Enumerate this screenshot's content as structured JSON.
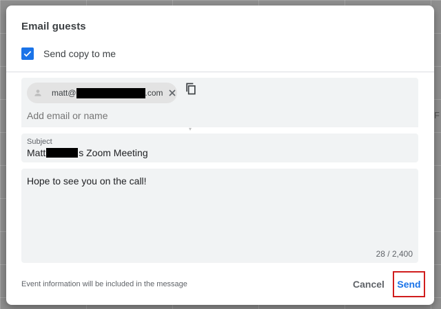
{
  "dialog": {
    "title": "Email guests",
    "send_copy": {
      "label": "Send copy to me",
      "checked": true
    }
  },
  "recipients": {
    "chip_prefix": "matt@",
    "chip_suffix": ".com",
    "placeholder": "Add email or name"
  },
  "subject": {
    "label": "Subject",
    "value_prefix": "Matt",
    "value_suffix": "s Zoom Meeting"
  },
  "message": {
    "text": "Hope to see you on the call!",
    "counter": "28 / 2,400"
  },
  "footer": {
    "note": "Event information will be included in the message",
    "cancel_label": "Cancel",
    "send_label": "Send"
  },
  "colors": {
    "accent": "#1a73e8",
    "highlight_border": "#d01c1c",
    "field_bg": "#f1f3f4"
  },
  "icons": {
    "checkbox": "check-icon",
    "avatar": "person-icon",
    "remove": "close-icon",
    "copy": "copy-icon"
  }
}
